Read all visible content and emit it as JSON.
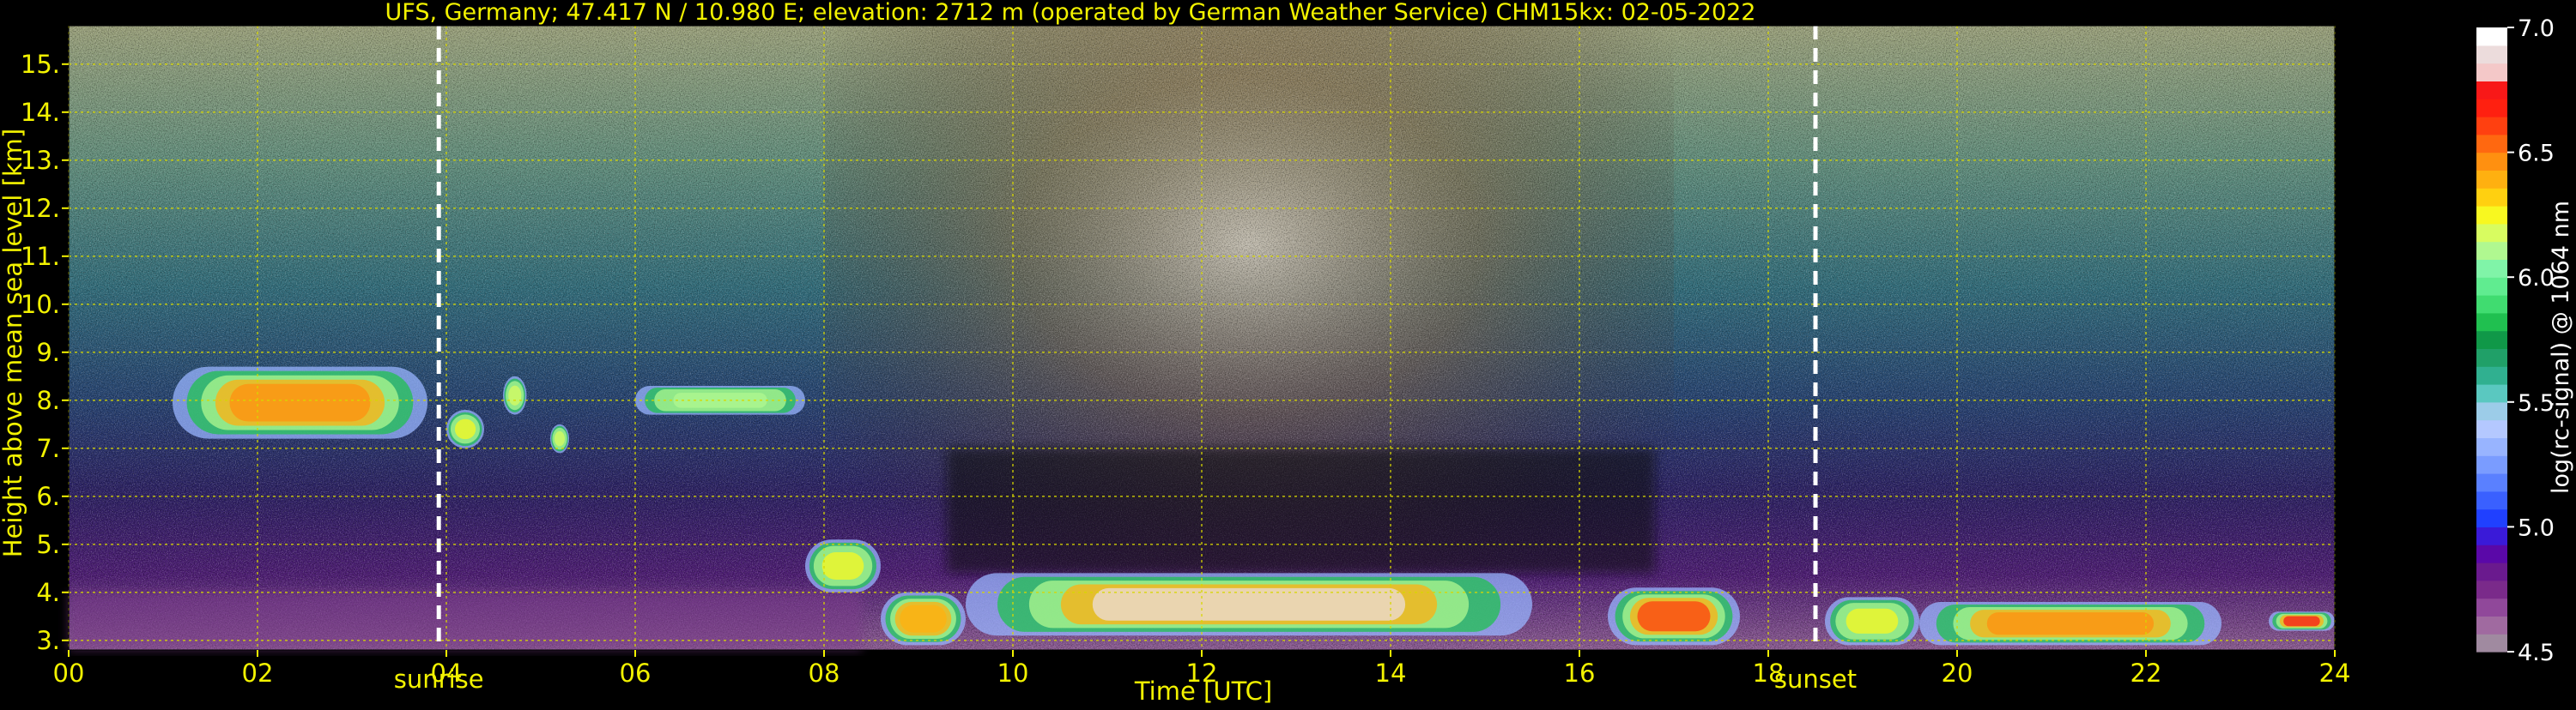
{
  "chart_data": {
    "type": "heatmap",
    "title": "UFS, Germany; 47.417 N / 10.980 E; elevation: 2712 m  (operated by German Weather Service)    CHM15kx: 02-05-2022",
    "xlabel": "Time [UTC]",
    "ylabel": "Height above mean sea level [km]",
    "xlim": [
      0,
      24
    ],
    "ylim": [
      2.8,
      15.8
    ],
    "x_ticks": [
      "00",
      "02",
      "04",
      "06",
      "08",
      "10",
      "12",
      "14",
      "16",
      "18",
      "20",
      "22",
      "24"
    ],
    "x_tick_values": [
      0,
      2,
      4,
      6,
      8,
      10,
      12,
      14,
      16,
      18,
      20,
      22,
      24
    ],
    "y_ticks": [
      "3.",
      "4.",
      "5.",
      "6.",
      "7.",
      "8.",
      "9.",
      "10.",
      "11.",
      "12.",
      "13.",
      "14.",
      "15."
    ],
    "y_tick_values": [
      3,
      4,
      5,
      6,
      7,
      8,
      9,
      10,
      11,
      12,
      13,
      14,
      15
    ],
    "grid": true,
    "grid_color": "#d8d800",
    "background_color": "#000000",
    "events": [
      {
        "label": "sunrise",
        "time": 3.92
      },
      {
        "label": "sunset",
        "time": 18.5
      }
    ],
    "colorbar": {
      "label": "log(rc-signal) @ 1064 nm",
      "min": 4.5,
      "max": 7.0,
      "ticks": [
        "4.5",
        "5.0",
        "5.5",
        "6.0",
        "6.5",
        "7.0"
      ],
      "tick_values": [
        4.5,
        5.0,
        5.5,
        6.0,
        6.5,
        7.0
      ],
      "colors": [
        "#a08aa0",
        "#a06aa0",
        "#90489a",
        "#7a2a8a",
        "#6a1a8e",
        "#5a08a8",
        "#3a1ad8",
        "#2040ff",
        "#3a60ff",
        "#5a80ff",
        "#7a9cff",
        "#98b4ff",
        "#b4c8ff",
        "#9ccce8",
        "#5ac8c0",
        "#30b090",
        "#20a068",
        "#109848",
        "#20c050",
        "#40dc70",
        "#60ec90",
        "#80f4a8",
        "#b0f890",
        "#d8fc60",
        "#f8f820",
        "#ffd010",
        "#ffb010",
        "#ff9010",
        "#ff6810",
        "#ff4010",
        "#ff2010",
        "#f81818",
        "#f4c8c8",
        "#ecdcdc",
        "#ffffff"
      ]
    },
    "cloud_layers": [
      {
        "t0": 1.1,
        "t1": 3.8,
        "h0": 7.2,
        "h1": 8.7,
        "peak": 6.5
      },
      {
        "t0": 4.0,
        "t1": 4.4,
        "h0": 7.0,
        "h1": 7.8,
        "peak": 6.3
      },
      {
        "t0": 4.6,
        "t1": 4.85,
        "h0": 7.7,
        "h1": 8.5,
        "peak": 6.2
      },
      {
        "t0": 5.1,
        "t1": 5.3,
        "h0": 6.9,
        "h1": 7.5,
        "peak": 6.2
      },
      {
        "t0": 6.0,
        "t1": 7.8,
        "h0": 7.7,
        "h1": 8.3,
        "peak": 6.1
      },
      {
        "t0": 7.8,
        "t1": 8.6,
        "h0": 4.0,
        "h1": 5.1,
        "peak": 6.3
      },
      {
        "t0": 8.6,
        "t1": 9.5,
        "h0": 2.9,
        "h1": 4.0,
        "peak": 6.4
      },
      {
        "t0": 9.5,
        "t1": 15.5,
        "h0": 3.1,
        "h1": 4.4,
        "peak": 6.9
      },
      {
        "t0": 16.3,
        "t1": 17.7,
        "h0": 2.9,
        "h1": 4.1,
        "peak": 6.6
      },
      {
        "t0": 18.6,
        "t1": 19.6,
        "h0": 2.9,
        "h1": 3.9,
        "peak": 6.3
      },
      {
        "t0": 19.6,
        "t1": 22.8,
        "h0": 2.9,
        "h1": 3.8,
        "peak": 6.5
      },
      {
        "t0": 23.3,
        "t1": 24.0,
        "h0": 3.2,
        "h1": 3.6,
        "peak": 6.8
      }
    ]
  }
}
